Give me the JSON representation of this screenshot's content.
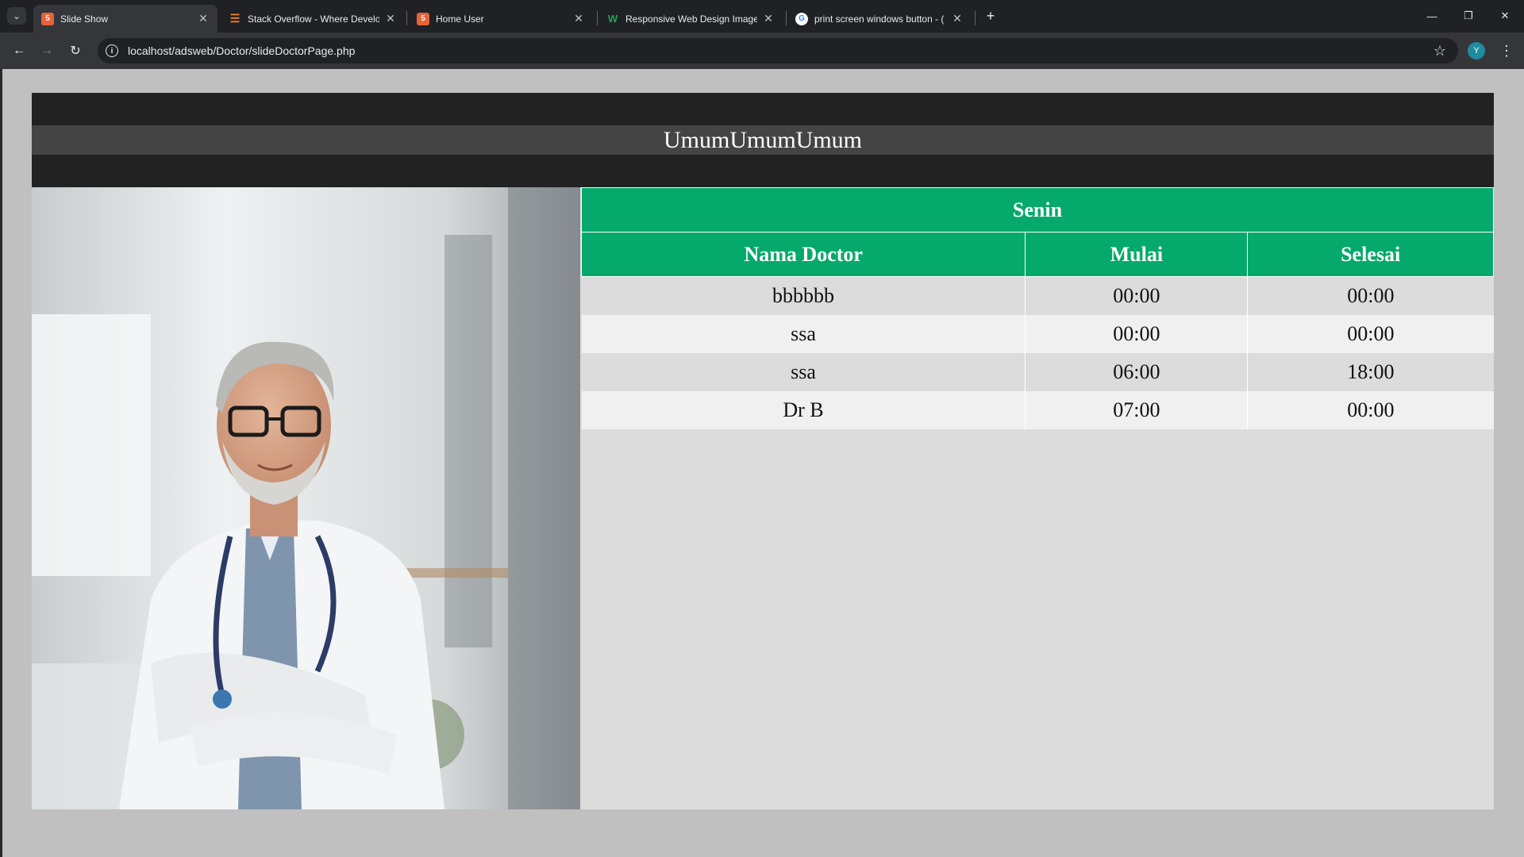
{
  "browser": {
    "tabs": [
      {
        "title": "Slide Show",
        "active": true,
        "favicon": "html-file-icon"
      },
      {
        "title": "Stack Overflow - Where Develo",
        "active": false,
        "favicon": "stackoverflow-icon"
      },
      {
        "title": "Home User",
        "active": false,
        "favicon": "html-file-icon"
      },
      {
        "title": "Responsive Web Design Images",
        "active": false,
        "favicon": "w3schools-icon"
      },
      {
        "title": "print screen windows button - (",
        "active": false,
        "favicon": "google-icon"
      }
    ],
    "address": "localhost/adsweb/Doctor/slideDoctorPage.php",
    "profile_initial": "Y"
  },
  "page": {
    "header_title": "UmumUmumUmum",
    "schedule": {
      "day": "Senin",
      "columns": [
        "Nama Doctor",
        "Mulai",
        "Selesai"
      ],
      "rows": [
        [
          "bbbbbb",
          "00:00",
          "00:00"
        ],
        [
          "ssa",
          "00:00",
          "00:00"
        ],
        [
          "ssa",
          "06:00",
          "18:00"
        ],
        [
          "Dr B",
          "07:00",
          "00:00"
        ]
      ]
    }
  },
  "colors": {
    "table_header": "#05a96b",
    "header_bar": "#222222",
    "header_band": "#444444"
  }
}
